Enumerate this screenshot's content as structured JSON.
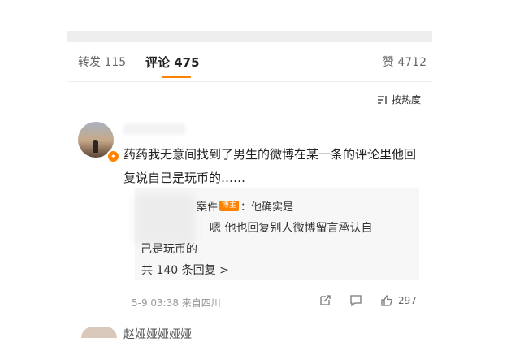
{
  "tabs": {
    "repost": "转发 115",
    "comment": "评论 475",
    "like": "赞 4712"
  },
  "sort": {
    "label": "按热度"
  },
  "comment": {
    "text": "药药我无意间找到了男生的微博在某一条的评论里他回复说自己是玩币的……",
    "reply": {
      "name": "案件",
      "badge": "博主",
      "text": "：他确实是",
      "line2": "嗯 他也回复别人微博留言承认自己是玩币的",
      "line2a": "嗯 他也回复别人微博留言承认自",
      "line2b": "己是玩币的",
      "more": "共 140 条回复 >"
    },
    "meta": "5-9 03:38  来自四川",
    "likes": "297"
  },
  "next_comment": {
    "name": "赵娅娅娅娅娅"
  },
  "colors": {
    "accent": "#ff8200",
    "reply_bg": "#f7f7f7"
  },
  "icons": [
    "sort-icon",
    "share-icon",
    "comment-icon",
    "like-icon"
  ]
}
